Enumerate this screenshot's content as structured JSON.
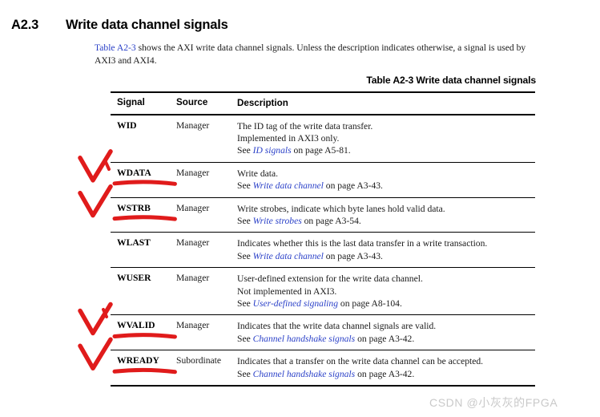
{
  "section": {
    "number": "A2.3",
    "title": "Write data channel signals"
  },
  "intro": {
    "link_text": "Table A2-3",
    "text_after_link": " shows the AXI write data channel signals. Unless the description indicates otherwise, a signal is used by AXI3 and AXI4."
  },
  "table_caption": "Table A2-3 Write data channel signals",
  "table": {
    "columns": [
      "Signal",
      "Source",
      "Description"
    ],
    "rows": [
      {
        "signal": "WID",
        "source": "Manager",
        "description_lines": [
          {
            "pre": "The ID tag of the write data transfer.",
            "link": "",
            "post": ""
          },
          {
            "pre": "Implemented in AXI3 only.",
            "link": "",
            "post": ""
          },
          {
            "pre": "See ",
            "link": "ID signals",
            "post": " on page A5-81."
          }
        ],
        "marked": false
      },
      {
        "signal": "WDATA",
        "source": "Manager",
        "description_lines": [
          {
            "pre": "Write data.",
            "link": "",
            "post": ""
          },
          {
            "pre": "See ",
            "link": "Write data channel",
            "post": " on page A3-43."
          }
        ],
        "marked": true
      },
      {
        "signal": "WSTRB",
        "source": "Manager",
        "description_lines": [
          {
            "pre": "Write strobes, indicate which byte lanes hold valid data.",
            "link": "",
            "post": ""
          },
          {
            "pre": "See ",
            "link": "Write strobes",
            "post": " on page A3-54."
          }
        ],
        "marked": true
      },
      {
        "signal": "WLAST",
        "source": "Manager",
        "description_lines": [
          {
            "pre": "Indicates whether this is the last data transfer in a write transaction.",
            "link": "",
            "post": ""
          },
          {
            "pre": "See ",
            "link": "Write data channel",
            "post": " on page A3-43."
          }
        ],
        "marked": false
      },
      {
        "signal": "WUSER",
        "source": "Manager",
        "description_lines": [
          {
            "pre": "User-defined extension for the write data channel.",
            "link": "",
            "post": ""
          },
          {
            "pre": "Not implemented in AXI3.",
            "link": "",
            "post": ""
          },
          {
            "pre": "See ",
            "link": "User-defined signaling",
            "post": " on page A8-104."
          }
        ],
        "marked": false
      },
      {
        "signal": "WVALID",
        "source": "Manager",
        "description_lines": [
          {
            "pre": "Indicates that the write data channel signals are valid.",
            "link": "",
            "post": ""
          },
          {
            "pre": "See ",
            "link": "Channel handshake signals",
            "post": " on page A3-42."
          }
        ],
        "marked": true
      },
      {
        "signal": "WREADY",
        "source": "Subordinate",
        "description_lines": [
          {
            "pre": "Indicates that a transfer on the write data channel can be accepted.",
            "link": "",
            "post": ""
          },
          {
            "pre": "See ",
            "link": "Channel handshake signals",
            "post": " on page A3-42."
          }
        ],
        "marked": true
      }
    ]
  },
  "annotations": {
    "color": "#e01b1b",
    "checkmarks": [
      {
        "signal": "WDATA"
      },
      {
        "signal": "WSTRB"
      },
      {
        "signal": "WVALID"
      },
      {
        "signal": "WREADY"
      }
    ],
    "underlines": [
      {
        "signal": "WDATA"
      },
      {
        "signal": "WSTRB"
      },
      {
        "signal": "WVALID"
      },
      {
        "signal": "WREADY"
      }
    ]
  },
  "watermark": "CSDN @小灰灰的FPGA",
  "colors": {
    "link_blue": "#2b41c8",
    "annotation_red": "#e01b1b",
    "watermark_gray": "#c9c9c9"
  }
}
